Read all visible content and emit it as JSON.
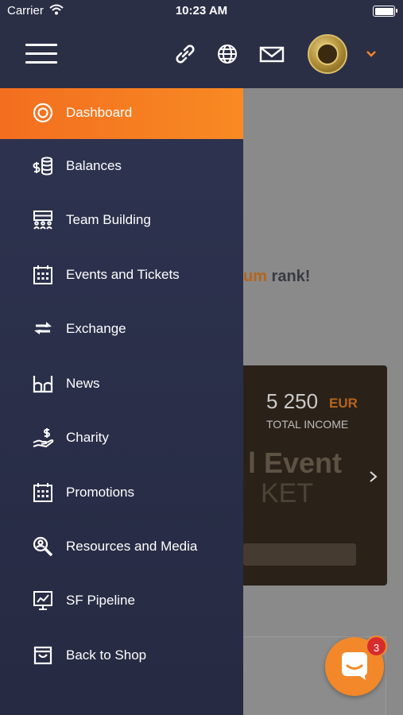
{
  "status_bar": {
    "carrier": "Carrier",
    "time": "10:23 AM"
  },
  "header": {
    "icons": [
      "link-icon",
      "globe-icon",
      "mail-icon"
    ],
    "avatar": "user-avatar",
    "chevron": "chevron-down-icon"
  },
  "menu": {
    "items": [
      {
        "label": "Dashboard",
        "icon": "dashboard-icon",
        "active": true
      },
      {
        "label": "Balances",
        "icon": "balances-icon"
      },
      {
        "label": "Team Building",
        "icon": "team-icon"
      },
      {
        "label": "Events and Tickets",
        "icon": "calendar-icon"
      },
      {
        "label": "Exchange",
        "icon": "exchange-icon"
      },
      {
        "label": "News",
        "icon": "news-icon"
      },
      {
        "label": "Charity",
        "icon": "charity-icon"
      },
      {
        "label": "Promotions",
        "icon": "promotions-icon"
      },
      {
        "label": "Resources and Media",
        "icon": "resources-icon"
      },
      {
        "label": "SF Pipeline",
        "icon": "pipeline-icon"
      },
      {
        "label": "Back to Shop",
        "icon": "shop-icon"
      }
    ]
  },
  "background": {
    "rank_highlight": "um",
    "rank_text": " rank!",
    "income_amount": "5 250",
    "income_currency": "EUR",
    "income_label": "TOTAL INCOME",
    "event_text_1": "l Event",
    "event_text_2": "KET"
  },
  "chat": {
    "badge": "3"
  },
  "colors": {
    "accent": "#f36e1f",
    "drawer": "#2e3350",
    "header": "#2b2f46"
  }
}
